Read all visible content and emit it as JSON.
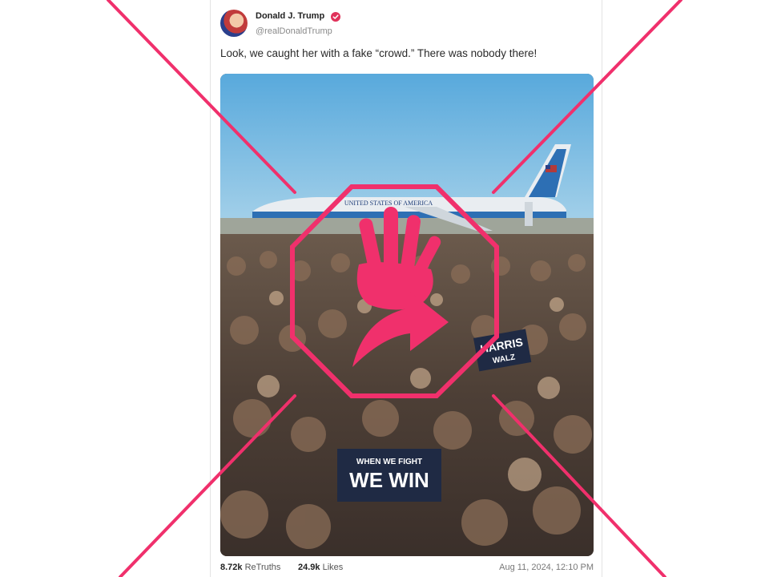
{
  "post": {
    "display_name": "Donald J. Trump",
    "handle": "@realDonaldTrump",
    "verified_icon": "verified-badge-icon",
    "text": "Look, we caught her with a fake “crowd.” There was nobody there!",
    "image": {
      "plane_text": "UNITED STATES OF AMERICA",
      "sign_harris_line1": "HARRIS",
      "sign_harris_line2": "WALZ",
      "sign_win_line1": "WHEN WE FIGHT",
      "sign_win_line2": "WE WIN"
    },
    "retruths_count": "8.72k",
    "retruths_label": "ReTruths",
    "likes_count": "24.9k",
    "likes_label": "Likes",
    "timestamp": "Aug 11, 2024, 12:10 PM"
  },
  "overlay": {
    "icon": "stop-hand-icon",
    "accent_color": "#f0306c"
  }
}
